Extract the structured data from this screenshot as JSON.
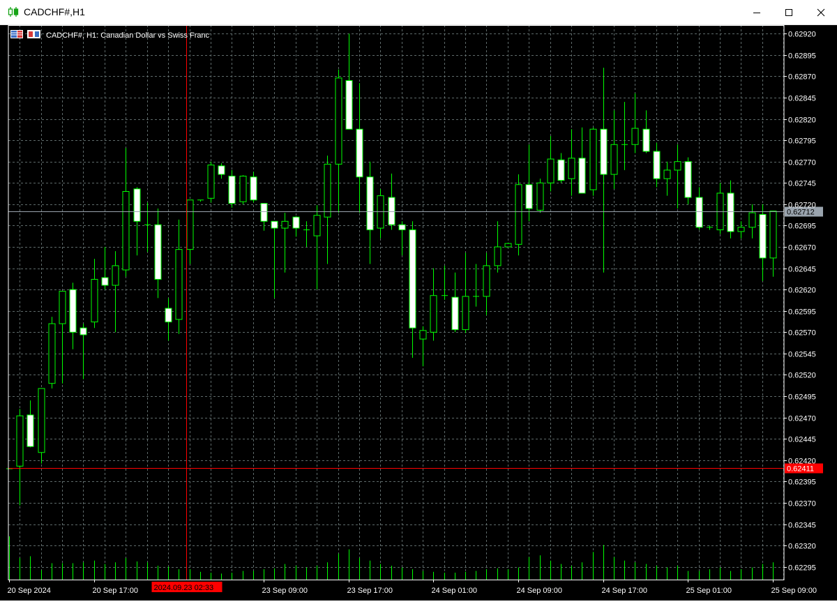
{
  "window": {
    "title": "CADCHF#,H1",
    "buttons": [
      "minimize",
      "maximize",
      "close"
    ]
  },
  "colors": {
    "background": "#000000",
    "grid": "#5f6b6b",
    "bull_fill": "#000000",
    "bear_fill": "#ffffff",
    "candle_outline": "#00ff00",
    "volume": "#00ff00",
    "axis_text": "#ffffff",
    "bid_line": "#ff0000",
    "last_price_line": "#9aa4ae",
    "crosshair": "#ff0000"
  },
  "chart_data": {
    "type": "candlestick",
    "symbol_label": "CADCHF#, H1:  Canadian Dollar vs Swiss Franc",
    "timeframe": "H1",
    "ylim": [
      0.6228,
      0.6293
    ],
    "y_ticks": [
      "0.62920",
      "0.62895",
      "0.62870",
      "0.62845",
      "0.62820",
      "0.62795",
      "0.62770",
      "0.62745",
      "0.62720",
      "0.62695",
      "0.62670",
      "0.62645",
      "0.62620",
      "0.62595",
      "0.62570",
      "0.62545",
      "0.62520",
      "0.62495",
      "0.62470",
      "0.62445",
      "0.62420",
      "0.62395",
      "0.62370",
      "0.62345",
      "0.62320",
      "0.62295"
    ],
    "x_labels": [
      {
        "index": 0,
        "text": "20 Sep 2024"
      },
      {
        "index": 8,
        "text": "20 Sep 17:00"
      },
      {
        "index": 24,
        "text": "23 Sep 09:00"
      },
      {
        "index": 32,
        "text": "23 Sep 17:00"
      },
      {
        "index": 40,
        "text": "24 Sep 01:00"
      },
      {
        "index": 48,
        "text": "24 Sep 09:00"
      },
      {
        "index": 56,
        "text": "24 Sep 17:00"
      },
      {
        "index": 64,
        "text": "25 Sep 01:00"
      },
      {
        "index": 72,
        "text": "25 Sep 09:00"
      }
    ],
    "bid_price": {
      "value": 0.62411,
      "label": "0.62411"
    },
    "last_price": {
      "value": 0.62712,
      "label": "0.62712"
    },
    "crosshair": {
      "index": 16.7,
      "label": "2024.09.23 02:33"
    },
    "candles": [
      {
        "o": 0.6241,
        "h": 0.6241,
        "l": 0.6241,
        "c": 0.6241,
        "v": 50
      },
      {
        "o": 0.62413,
        "h": 0.6248,
        "l": 0.62367,
        "c": 0.62472,
        "v": 25
      },
      {
        "o": 0.62473,
        "h": 0.6249,
        "l": 0.62435,
        "c": 0.62436,
        "v": 27
      },
      {
        "o": 0.62429,
        "h": 0.62504,
        "l": 0.62416,
        "c": 0.62504,
        "v": 11
      },
      {
        "o": 0.6251,
        "h": 0.62588,
        "l": 0.62504,
        "c": 0.6258,
        "v": 19
      },
      {
        "o": 0.6258,
        "h": 0.62618,
        "l": 0.6251,
        "c": 0.62618,
        "v": 19
      },
      {
        "o": 0.6262,
        "h": 0.62628,
        "l": 0.6255,
        "c": 0.6257,
        "v": 19
      },
      {
        "o": 0.62575,
        "h": 0.6258,
        "l": 0.62515,
        "c": 0.62567,
        "v": 20
      },
      {
        "o": 0.62582,
        "h": 0.62656,
        "l": 0.62575,
        "c": 0.62632,
        "v": 22
      },
      {
        "o": 0.62634,
        "h": 0.6267,
        "l": 0.6262,
        "c": 0.62625,
        "v": 18
      },
      {
        "o": 0.62625,
        "h": 0.62665,
        "l": 0.6257,
        "c": 0.62648,
        "v": 20
      },
      {
        "o": 0.62643,
        "h": 0.62786,
        "l": 0.62635,
        "c": 0.62735,
        "v": 25
      },
      {
        "o": 0.62738,
        "h": 0.6274,
        "l": 0.6266,
        "c": 0.627,
        "v": 21
      },
      {
        "o": 0.62696,
        "h": 0.62722,
        "l": 0.62664,
        "c": 0.62696,
        "v": 20
      },
      {
        "o": 0.62696,
        "h": 0.62715,
        "l": 0.6261,
        "c": 0.62632,
        "v": 16
      },
      {
        "o": 0.62598,
        "h": 0.6261,
        "l": 0.6256,
        "c": 0.62582,
        "v": 15
      },
      {
        "o": 0.62585,
        "h": 0.62702,
        "l": 0.62568,
        "c": 0.62667,
        "v": 12
      },
      {
        "o": 0.62667,
        "h": 0.62725,
        "l": 0.6265,
        "c": 0.62725,
        "v": 12
      },
      {
        "o": 0.62725,
        "h": 0.62725,
        "l": 0.62723,
        "c": 0.62723,
        "v": 9
      },
      {
        "o": 0.62727,
        "h": 0.6277,
        "l": 0.62722,
        "c": 0.62766,
        "v": 8
      },
      {
        "o": 0.62765,
        "h": 0.62768,
        "l": 0.6275,
        "c": 0.62755,
        "v": 7
      },
      {
        "o": 0.62753,
        "h": 0.6276,
        "l": 0.62716,
        "c": 0.62721,
        "v": 8
      },
      {
        "o": 0.62723,
        "h": 0.62754,
        "l": 0.6272,
        "c": 0.62753,
        "v": 10
      },
      {
        "o": 0.62752,
        "h": 0.62758,
        "l": 0.62722,
        "c": 0.62725,
        "v": 10
      },
      {
        "o": 0.62721,
        "h": 0.62721,
        "l": 0.62689,
        "c": 0.627,
        "v": 12
      },
      {
        "o": 0.627,
        "h": 0.627,
        "l": 0.6261,
        "c": 0.62692,
        "v": 13
      },
      {
        "o": 0.62692,
        "h": 0.6271,
        "l": 0.6264,
        "c": 0.627,
        "v": 18
      },
      {
        "o": 0.62705,
        "h": 0.62706,
        "l": 0.62682,
        "c": 0.62692,
        "v": 16
      },
      {
        "o": 0.6269,
        "h": 0.627,
        "l": 0.6267,
        "c": 0.62687,
        "v": 14
      },
      {
        "o": 0.62683,
        "h": 0.62719,
        "l": 0.6262,
        "c": 0.62707,
        "v": 16
      },
      {
        "o": 0.62705,
        "h": 0.62777,
        "l": 0.6265,
        "c": 0.62767,
        "v": 20
      },
      {
        "o": 0.62767,
        "h": 0.62878,
        "l": 0.6271,
        "c": 0.62868,
        "v": 30
      },
      {
        "o": 0.62865,
        "h": 0.6292,
        "l": 0.62847,
        "c": 0.62808,
        "v": 35
      },
      {
        "o": 0.62808,
        "h": 0.62862,
        "l": 0.6271,
        "c": 0.62752,
        "v": 25
      },
      {
        "o": 0.62752,
        "h": 0.6277,
        "l": 0.6265,
        "c": 0.6269,
        "v": 22
      },
      {
        "o": 0.62692,
        "h": 0.62738,
        "l": 0.6268,
        "c": 0.6273,
        "v": 18
      },
      {
        "o": 0.62728,
        "h": 0.62756,
        "l": 0.6269,
        "c": 0.62696,
        "v": 16
      },
      {
        "o": 0.62696,
        "h": 0.627,
        "l": 0.6266,
        "c": 0.6269,
        "v": 14
      },
      {
        "o": 0.6269,
        "h": 0.627,
        "l": 0.6254,
        "c": 0.62575,
        "v": 12
      },
      {
        "o": 0.62562,
        "h": 0.62577,
        "l": 0.6253,
        "c": 0.62572,
        "v": 10
      },
      {
        "o": 0.6257,
        "h": 0.62645,
        "l": 0.6256,
        "c": 0.62613,
        "v": 9
      },
      {
        "o": 0.62613,
        "h": 0.62648,
        "l": 0.62608,
        "c": 0.6261,
        "v": 8
      },
      {
        "o": 0.62611,
        "h": 0.6264,
        "l": 0.6257,
        "c": 0.62573,
        "v": 8
      },
      {
        "o": 0.62573,
        "h": 0.62663,
        "l": 0.62569,
        "c": 0.62612,
        "v": 9
      },
      {
        "o": 0.62612,
        "h": 0.6265,
        "l": 0.626,
        "c": 0.6261,
        "v": 10
      },
      {
        "o": 0.62612,
        "h": 0.62663,
        "l": 0.6259,
        "c": 0.62648,
        "v": 12
      },
      {
        "o": 0.62648,
        "h": 0.627,
        "l": 0.6264,
        "c": 0.6267,
        "v": 13
      },
      {
        "o": 0.6267,
        "h": 0.62675,
        "l": 0.6267,
        "c": 0.62674,
        "v": 12
      },
      {
        "o": 0.62673,
        "h": 0.62755,
        "l": 0.6266,
        "c": 0.62743,
        "v": 14
      },
      {
        "o": 0.62743,
        "h": 0.6279,
        "l": 0.627,
        "c": 0.62715,
        "v": 26
      },
      {
        "o": 0.62713,
        "h": 0.6275,
        "l": 0.6271,
        "c": 0.62745,
        "v": 28
      },
      {
        "o": 0.62745,
        "h": 0.628,
        "l": 0.62735,
        "c": 0.62773,
        "v": 22
      },
      {
        "o": 0.62772,
        "h": 0.6278,
        "l": 0.62745,
        "c": 0.62748,
        "v": 18
      },
      {
        "o": 0.6275,
        "h": 0.62808,
        "l": 0.6273,
        "c": 0.62774,
        "v": 16
      },
      {
        "o": 0.62774,
        "h": 0.6281,
        "l": 0.6274,
        "c": 0.62733,
        "v": 20
      },
      {
        "o": 0.62737,
        "h": 0.6281,
        "l": 0.6273,
        "c": 0.62808,
        "v": 32
      },
      {
        "o": 0.62808,
        "h": 0.6288,
        "l": 0.6264,
        "c": 0.62755,
        "v": 40
      },
      {
        "o": 0.62755,
        "h": 0.6283,
        "l": 0.62738,
        "c": 0.6279,
        "v": 26
      },
      {
        "o": 0.6279,
        "h": 0.6284,
        "l": 0.6276,
        "c": 0.6279,
        "v": 22
      },
      {
        "o": 0.6279,
        "h": 0.6285,
        "l": 0.6278,
        "c": 0.62809,
        "v": 20
      },
      {
        "o": 0.62808,
        "h": 0.6283,
        "l": 0.6278,
        "c": 0.62782,
        "v": 18
      },
      {
        "o": 0.62782,
        "h": 0.62792,
        "l": 0.6274,
        "c": 0.6275,
        "v": 16
      },
      {
        "o": 0.6275,
        "h": 0.6277,
        "l": 0.6273,
        "c": 0.6276,
        "v": 14
      },
      {
        "o": 0.6276,
        "h": 0.6279,
        "l": 0.62715,
        "c": 0.6277,
        "v": 16
      },
      {
        "o": 0.6277,
        "h": 0.62775,
        "l": 0.6272,
        "c": 0.62728,
        "v": 10
      },
      {
        "o": 0.62728,
        "h": 0.6274,
        "l": 0.6269,
        "c": 0.62693,
        "v": 10
      },
      {
        "o": 0.62693,
        "h": 0.62695,
        "l": 0.6269,
        "c": 0.62693,
        "v": 12
      },
      {
        "o": 0.6269,
        "h": 0.62745,
        "l": 0.62685,
        "c": 0.62733,
        "v": 14
      },
      {
        "o": 0.62733,
        "h": 0.62748,
        "l": 0.6268,
        "c": 0.62688,
        "v": 10
      },
      {
        "o": 0.62688,
        "h": 0.627,
        "l": 0.6268,
        "c": 0.62693,
        "v": 12
      },
      {
        "o": 0.62693,
        "h": 0.6272,
        "l": 0.6268,
        "c": 0.6271,
        "v": 14
      },
      {
        "o": 0.62708,
        "h": 0.6272,
        "l": 0.6263,
        "c": 0.62657,
        "v": 18
      },
      {
        "o": 0.62657,
        "h": 0.62712,
        "l": 0.62635,
        "c": 0.62712,
        "v": 20
      }
    ]
  }
}
